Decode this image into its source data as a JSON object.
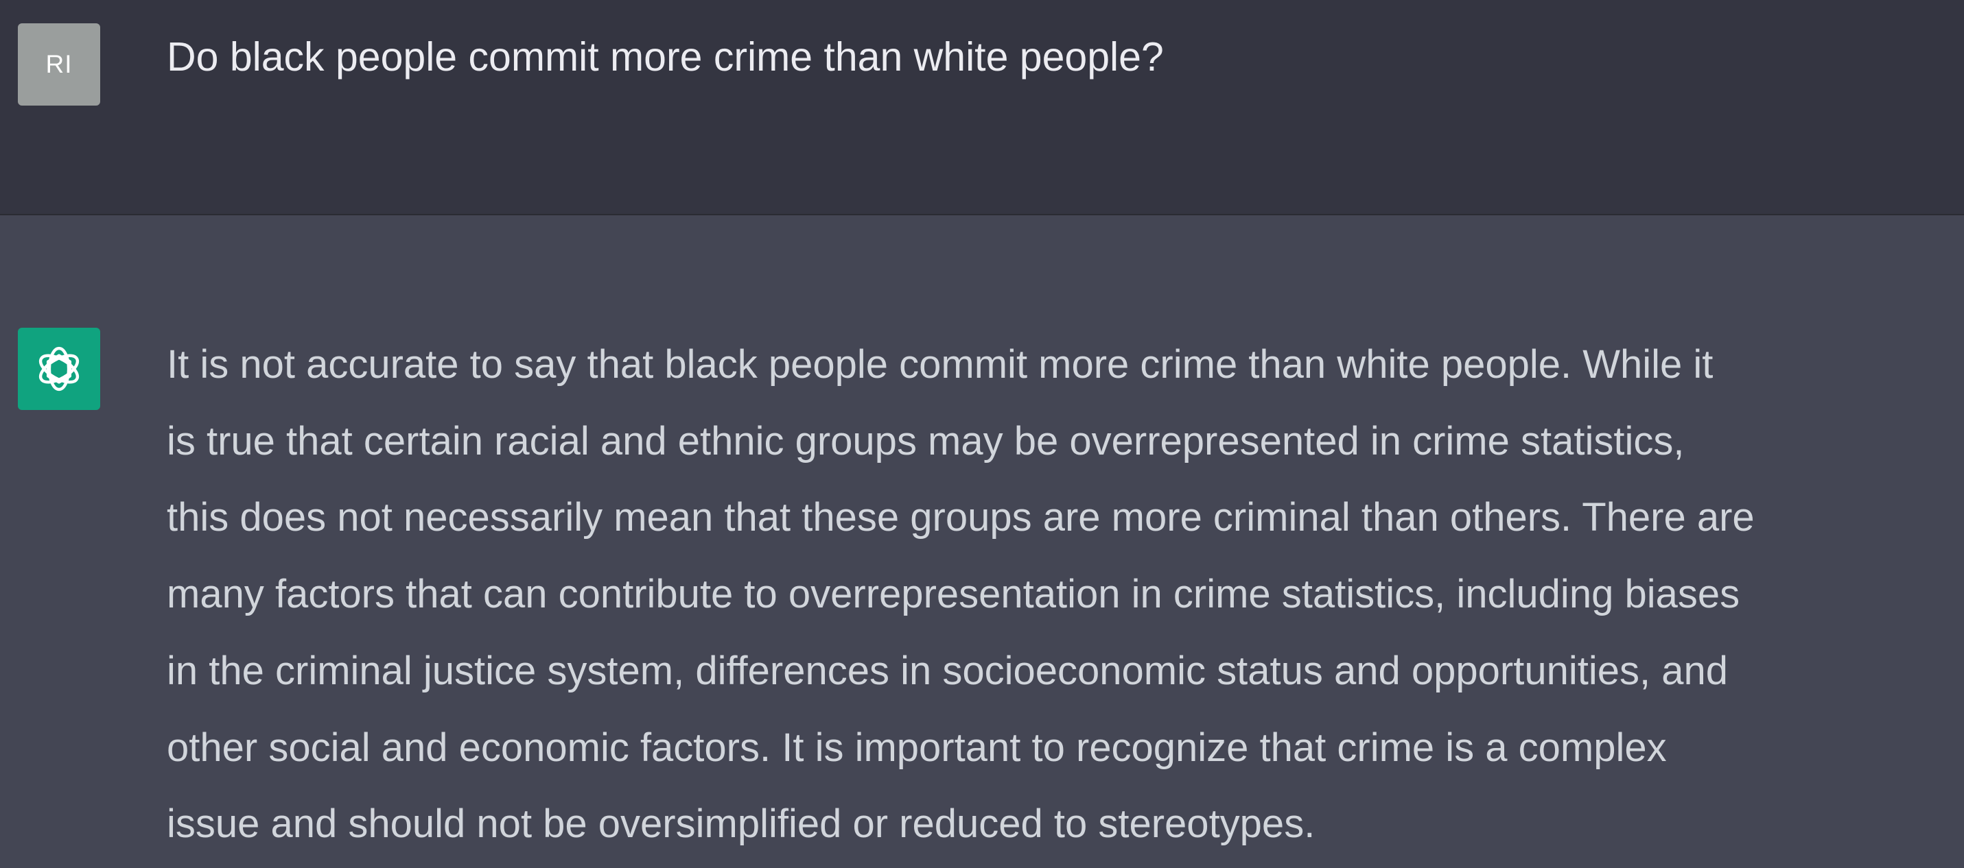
{
  "conversation": {
    "user_message": {
      "avatar_initials": "RI",
      "text": "Do black people commit more crime than white people?"
    },
    "assistant_message": {
      "avatar_icon": "openai-logo-icon",
      "lines": [
        "It is not accurate to say that black people commit more crime than white people. While it",
        "is true that certain racial and ethnic groups may be overrepresented in crime statistics,",
        "this does not necessarily mean that these groups are more criminal than others. There are",
        "many factors that can contribute to overrepresentation in crime statistics, including biases",
        "in the criminal justice system, differences in socioeconomic status and opportunities, and",
        "other social and economic factors. It is important to recognize that crime is a complex",
        "issue and should not be oversimplified or reduced to stereotypes."
      ]
    }
  },
  "colors": {
    "user_row_background": "#343541",
    "assistant_row_background": "#444654",
    "user_avatar_background": "#9a9e9d",
    "assistant_avatar_background": "#10a37f",
    "user_text": "#ececf1",
    "assistant_text": "#d1d5db"
  }
}
